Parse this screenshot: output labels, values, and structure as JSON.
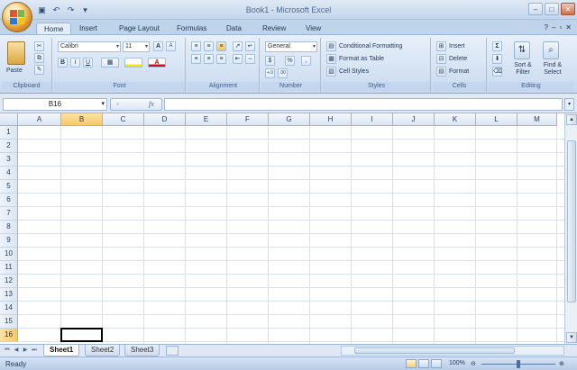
{
  "window": {
    "title": "Book1 - Microsoft Excel",
    "controls": {
      "minimize": "–",
      "maximize": "□",
      "close": "✕"
    }
  },
  "quick_access": [
    {
      "name": "save-icon",
      "glyph": "▣"
    },
    {
      "name": "undo-icon",
      "glyph": "↶"
    },
    {
      "name": "redo-icon",
      "glyph": "↷"
    },
    {
      "name": "customize-icon",
      "glyph": "▾"
    }
  ],
  "ribbon_tabs": [
    "Home",
    "Insert",
    "Page Layout",
    "Formulas",
    "Data",
    "Review",
    "View"
  ],
  "active_tab": "Home",
  "ribbon": {
    "clipboard": {
      "label": "Clipboard",
      "paste": "Paste"
    },
    "font": {
      "label": "Font",
      "font_name": "Calibri",
      "font_size": "11",
      "bold": "B",
      "italic": "I",
      "underline": "U"
    },
    "alignment": {
      "label": "Alignment"
    },
    "number": {
      "label": "Number",
      "format": "General",
      "currency": "$",
      "percent": "%",
      "comma": ","
    },
    "styles": {
      "label": "Styles",
      "conditional": "Conditional Formatting",
      "format_table": "Format as Table",
      "cell_styles": "Cell Styles"
    },
    "cells": {
      "label": "Cells",
      "insert": "Insert",
      "delete": "Delete",
      "format": "Format"
    },
    "editing": {
      "label": "Editing",
      "sigma": "Σ",
      "sort_filter": "Sort & Filter",
      "find_select": "Find & Select"
    }
  },
  "formula_bar": {
    "name_box": "B16",
    "fx": "fx",
    "formula": ""
  },
  "columns": [
    "A",
    "B",
    "C",
    "D",
    "E",
    "F",
    "G",
    "H",
    "I",
    "J",
    "K",
    "L",
    "M"
  ],
  "rows": [
    "1",
    "2",
    "3",
    "4",
    "5",
    "6",
    "7",
    "8",
    "9",
    "10",
    "11",
    "12",
    "13",
    "14",
    "15",
    "16"
  ],
  "selected_cell": {
    "column": "B",
    "row": "16"
  },
  "sheets": [
    "Sheet1",
    "Sheet2",
    "Sheet3"
  ],
  "active_sheet": "Sheet1",
  "status": {
    "text": "Ready",
    "zoom": "100%"
  }
}
